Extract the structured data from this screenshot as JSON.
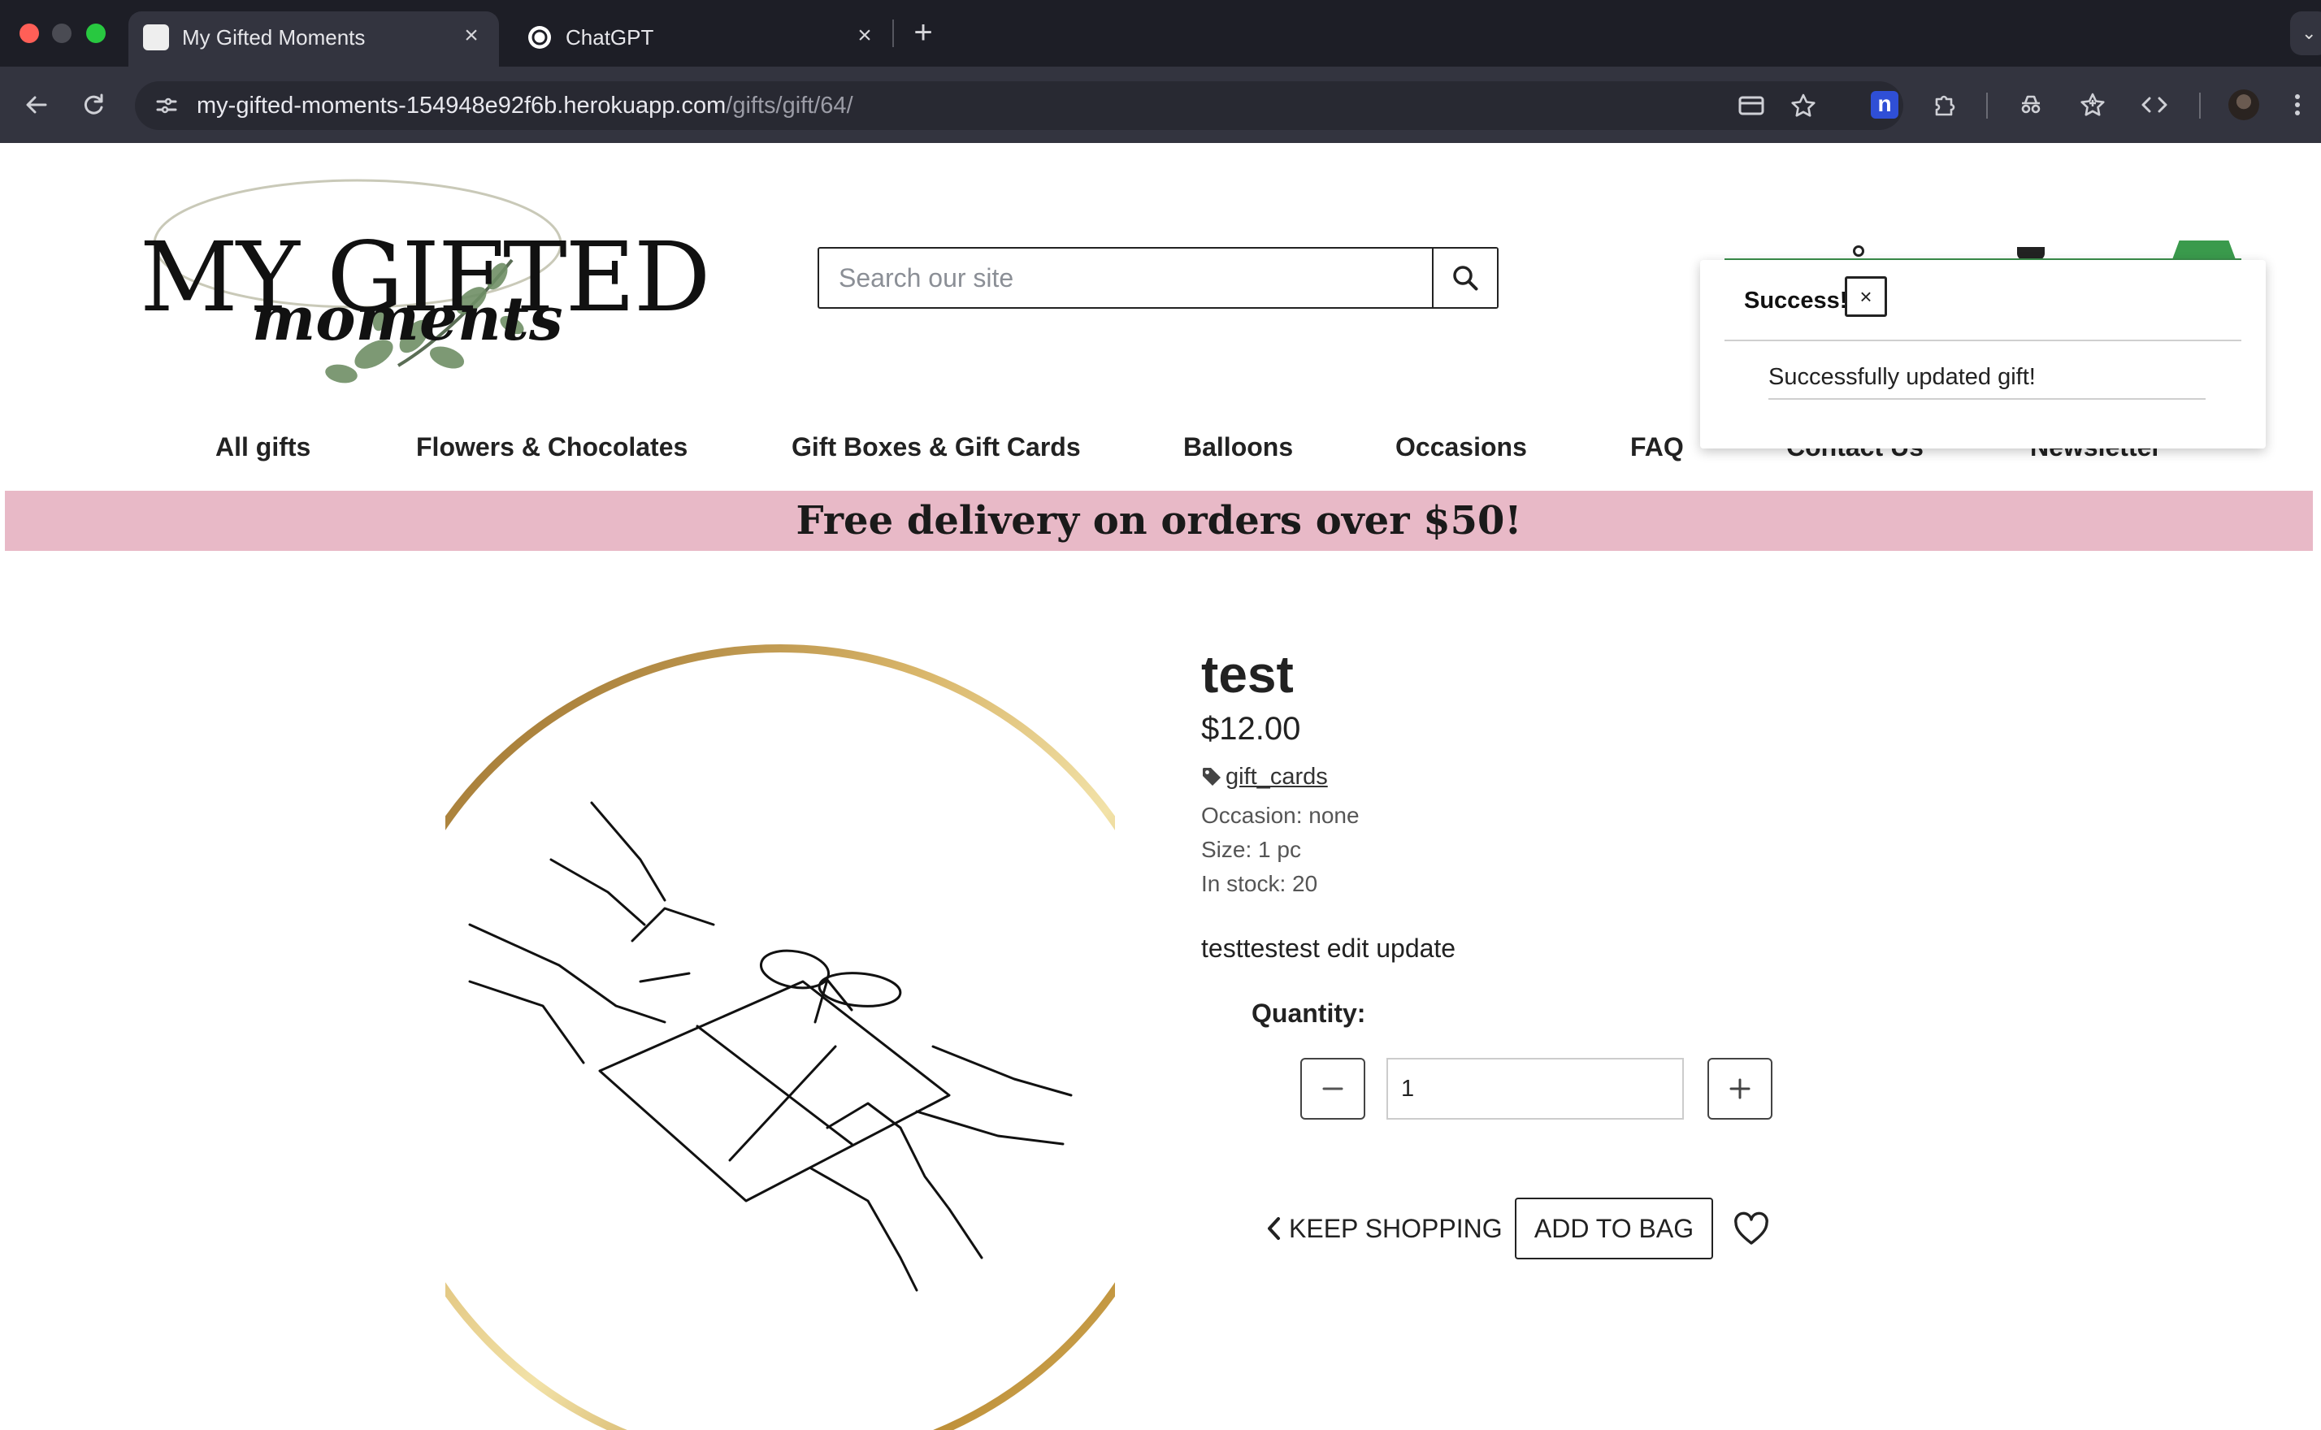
{
  "browser": {
    "tabs": [
      {
        "title": "My Gifted Moments",
        "active": true
      },
      {
        "title": "ChatGPT",
        "active": false
      }
    ],
    "new_tab_label": "+",
    "tab_close_label": "×",
    "url_host": "my-gifted-moments-154948e92f6b.herokuapp.com",
    "url_path": "/gifts/gift/64/",
    "extension_badge": "n"
  },
  "site": {
    "logo_text_main": "MY GIFTED",
    "logo_text_script": "moments",
    "search_placeholder": "Search our site",
    "nav": [
      "All gifts",
      "Flowers & Chocolates",
      "Gift Boxes & Gift Cards",
      "Balloons",
      "Occasions",
      "FAQ",
      "Contact Us",
      "Newsletter"
    ],
    "promo": "Free delivery on orders over $50!"
  },
  "toast": {
    "title": "Success!",
    "close_label": "×",
    "message": "Successfully updated gift!"
  },
  "product": {
    "name": "test",
    "price": "$12.00",
    "category": "gift_cards",
    "occasion": "Occasion: none",
    "size": "Size: 1 pc",
    "stock": "In stock: 20",
    "description": "testtestest edit update",
    "quantity_label": "Quantity:",
    "quantity_value": "1",
    "keep_shopping": "KEEP SHOPPING",
    "add_to_bag": "ADD TO BAG"
  },
  "colors": {
    "tabbar": "#1d1e26",
    "toolbar": "#33343f",
    "promo": "#e8b9c7",
    "header_accent": "#3a8f4b",
    "ring_gold": "#b8862b"
  }
}
